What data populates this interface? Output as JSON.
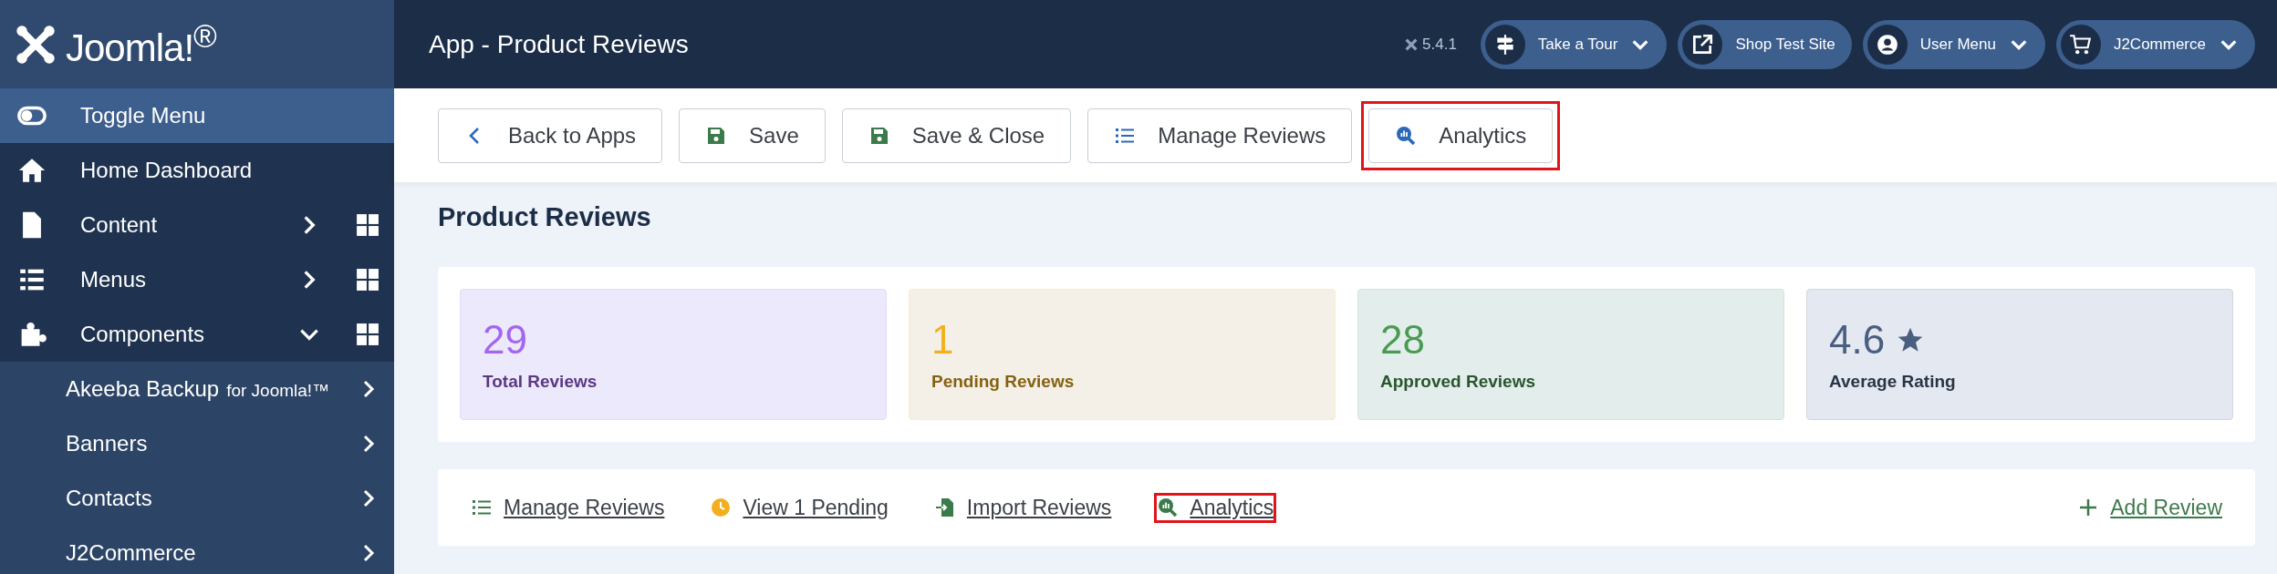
{
  "brand": {
    "name": "Joomla!$^{®}$"
  },
  "sidebar": {
    "items": [
      {
        "label": "Toggle Menu",
        "kind": "toggle",
        "selected": true
      },
      {
        "label": "Home Dashboard",
        "kind": "link",
        "selected": false
      },
      {
        "label": "Content",
        "kind": "group",
        "expanded": false,
        "selected": false
      },
      {
        "label": "Menus",
        "kind": "group",
        "expanded": false,
        "selected": false
      },
      {
        "label": "Components",
        "kind": "group",
        "expanded": true,
        "selected": false,
        "children": [
          {
            "label": "Akeeba Backup",
            "suffix": "for Joomla!™"
          },
          {
            "label": "Banners"
          },
          {
            "label": "Contacts"
          },
          {
            "label": "J2Commerce"
          }
        ]
      }
    ]
  },
  "header": {
    "title": "App - Product Reviews",
    "version": "5.4.1",
    "buttons": [
      {
        "label": "Take a Tour",
        "dropdown": true
      },
      {
        "label": "Shop Test Site",
        "dropdown": false
      },
      {
        "label": "User Menu",
        "dropdown": true
      },
      {
        "label": "J2Commerce",
        "dropdown": true
      }
    ]
  },
  "toolbar": {
    "buttons": [
      {
        "label": "Back to Apps",
        "highlighted": false
      },
      {
        "label": "Save",
        "highlighted": false
      },
      {
        "label": "Save & Close",
        "highlighted": false
      },
      {
        "label": "Manage Reviews",
        "highlighted": false
      },
      {
        "label": "Analytics",
        "highlighted": true
      }
    ]
  },
  "page_title": "Product Reviews",
  "stats": [
    {
      "value": "29",
      "label": "Total Reviews",
      "kind": "count",
      "color": "#a366f0"
    },
    {
      "value": "1",
      "label": "Pending Reviews",
      "kind": "count",
      "color": "#f2b01e"
    },
    {
      "value": "28",
      "label": "Approved Reviews",
      "kind": "count",
      "color": "#4a9a52"
    },
    {
      "value": "4.6",
      "label": "Average Rating",
      "kind": "rating",
      "color": "#4a5f80"
    }
  ],
  "links": [
    {
      "label": "Manage Reviews",
      "kind": "nav",
      "highlighted": false
    },
    {
      "label": "View 1 Pending",
      "kind": "nav",
      "highlighted": false
    },
    {
      "label": "Import Reviews",
      "kind": "nav",
      "highlighted": false
    },
    {
      "label": "Analytics",
      "kind": "nav",
      "highlighted": true
    },
    {
      "label": "Add Review",
      "kind": "action",
      "highlighted": false
    }
  ]
}
